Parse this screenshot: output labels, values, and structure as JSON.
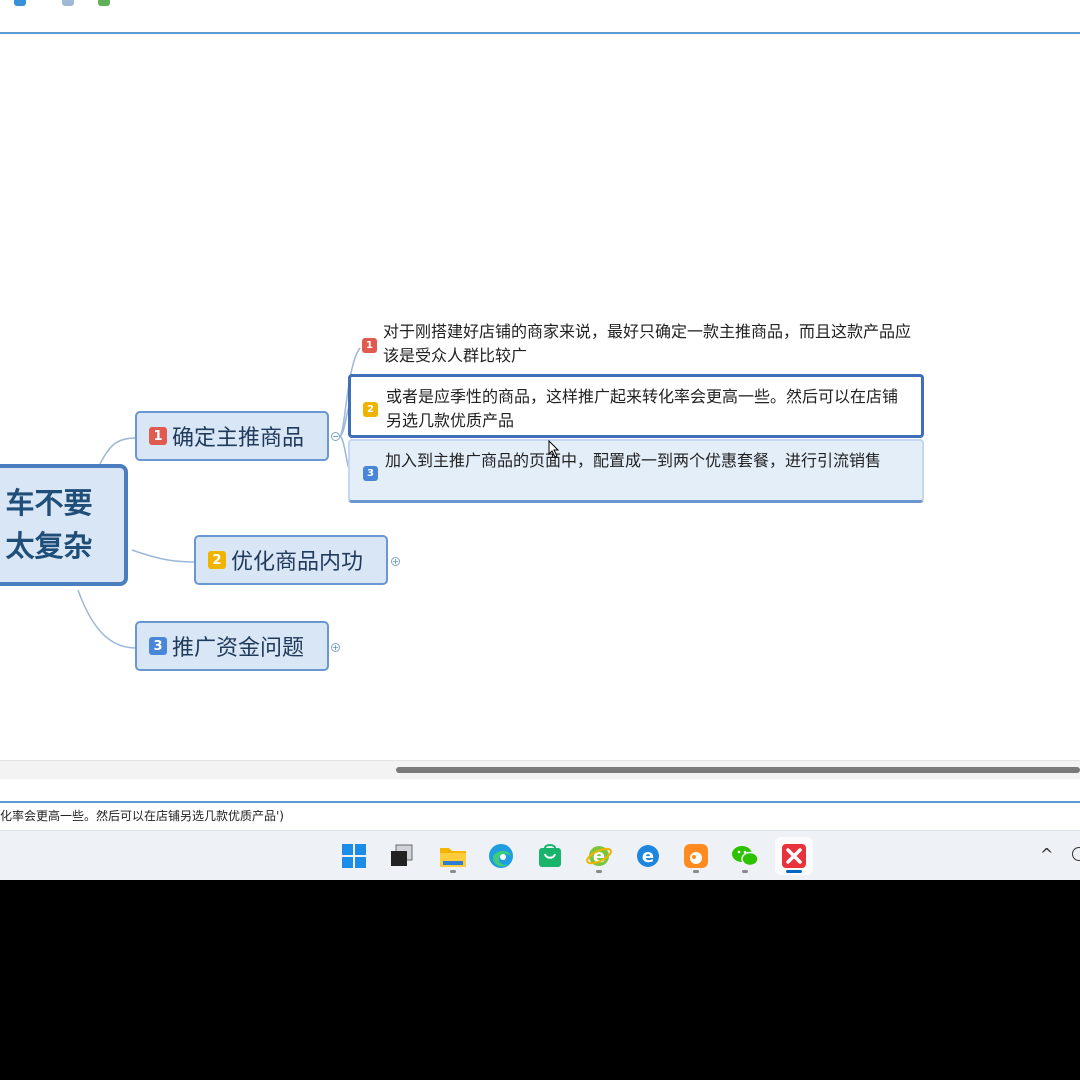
{
  "mindmap": {
    "central_topic": [
      "车不要",
      "太复杂"
    ],
    "branches": [
      {
        "badge": "1",
        "label": "确定主推商品",
        "collapse_symbol": "−"
      },
      {
        "badge": "2",
        "label": "优化商品内功",
        "collapse_symbol": "+"
      },
      {
        "badge": "3",
        "label": "推广资金问题",
        "collapse_symbol": "+"
      }
    ],
    "leaves": [
      {
        "badge": "1",
        "text": "对于刚搭建好店铺的商家来说，最好只确定一款主推商品，而且这款产品应该是受众人群比较广"
      },
      {
        "badge": "2",
        "text": "或者是应季性的商品，这样推广起来转化率会更高一些。然后可以在店铺另选几款优质产品"
      },
      {
        "badge": "3",
        "text": "加入到主推广商品的页面中，配置成一到两个优惠套餐，进行引流销售"
      }
    ]
  },
  "status_bar": {
    "text": "化率会更高一些。然后可以在店铺另选几款优质产品')"
  },
  "taskbar": {
    "apps": [
      {
        "icon": "windows-start-icon"
      },
      {
        "icon": "task-view-icon"
      },
      {
        "icon": "file-explorer-icon"
      },
      {
        "icon": "edge-browser-icon"
      },
      {
        "icon": "store-icon"
      },
      {
        "icon": "ie-browser-green-icon"
      },
      {
        "icon": "ie-browser-blue-icon"
      },
      {
        "icon": "uc-browser-icon"
      },
      {
        "icon": "wechat-icon"
      },
      {
        "icon": "xmind-icon"
      }
    ],
    "tray_chevron": "^"
  },
  "colors": {
    "accent": "#5b9bd5",
    "topic_fill": "#d9e6f5",
    "topic_border": "#4a7ebf",
    "badge_red": "#e05a4f",
    "badge_yellow": "#f0b400",
    "badge_blue": "#4a86d8"
  }
}
